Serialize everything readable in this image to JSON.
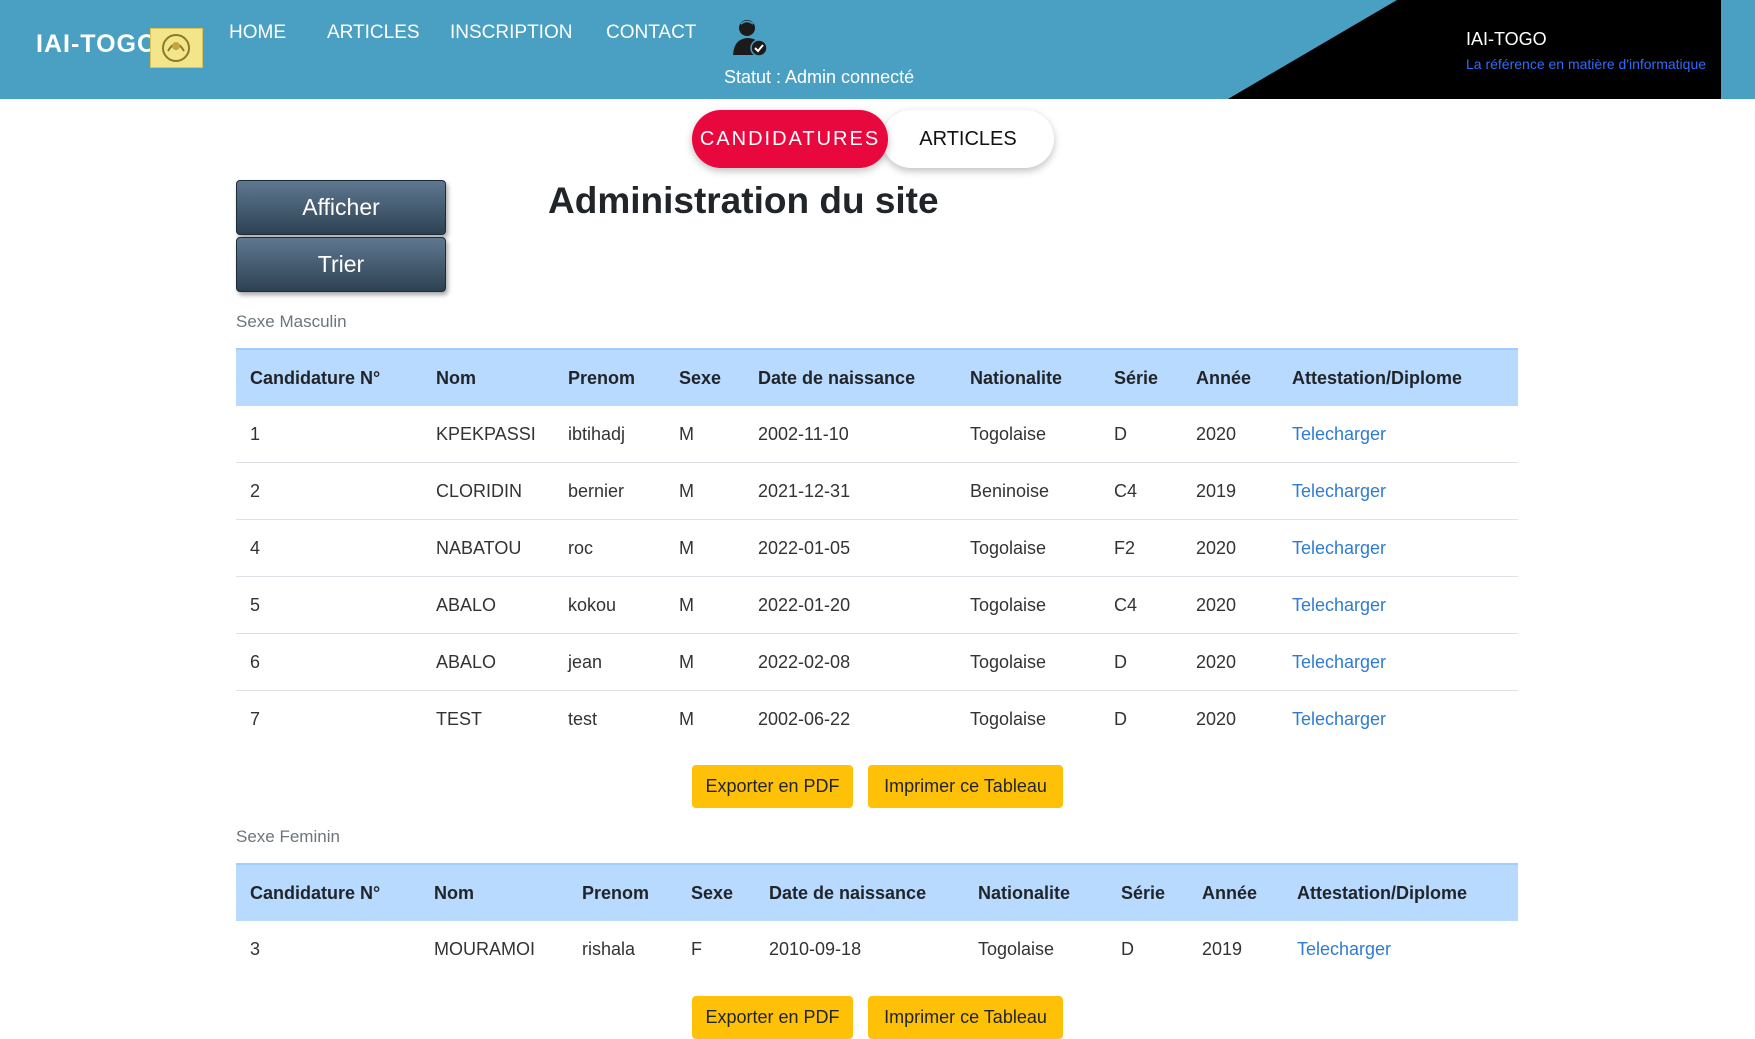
{
  "header": {
    "brand": "IAI-TOGO",
    "nav": [
      {
        "label": "HOME"
      },
      {
        "label": "ARTICLES"
      },
      {
        "label": "INSCRIPTION"
      },
      {
        "label": "CONTACT"
      }
    ],
    "status": "Statut : Admin connecté",
    "corner_title": "IAI-TOGO",
    "corner_subtitle": "La référence en matière d'informatique"
  },
  "pills": {
    "active": "CANDIDATURES",
    "other": "ARTICLES"
  },
  "sidebar": {
    "show_label": "Afficher",
    "sort_label": "Trier"
  },
  "page_title": "Administration du site",
  "table_headers": [
    "Candidature N°",
    "Nom",
    "Prenom",
    "Sexe",
    "Date de naissance",
    "Nationalite",
    "Série",
    "Année",
    "Attestation/Diplome"
  ],
  "male": {
    "label": "Sexe Masculin",
    "rows": [
      {
        "num": "1",
        "nom": "KPEKPASSI",
        "prenom": "ibtihadj",
        "sexe": "M",
        "date": "2002-11-10",
        "nationalite": "Togolaise",
        "serie": "D",
        "annee": "2020",
        "link": "Telecharger"
      },
      {
        "num": "2",
        "nom": "CLORIDIN",
        "prenom": "bernier",
        "sexe": "M",
        "date": "2021-12-31",
        "nationalite": "Beninoise",
        "serie": "C4",
        "annee": "2019",
        "link": "Telecharger"
      },
      {
        "num": "4",
        "nom": "NABATOU",
        "prenom": "roc",
        "sexe": "M",
        "date": "2022-01-05",
        "nationalite": "Togolaise",
        "serie": "F2",
        "annee": "2020",
        "link": "Telecharger"
      },
      {
        "num": "5",
        "nom": "ABALO",
        "prenom": "kokou",
        "sexe": "M",
        "date": "2022-01-20",
        "nationalite": "Togolaise",
        "serie": "C4",
        "annee": "2020",
        "link": "Telecharger"
      },
      {
        "num": "6",
        "nom": "ABALO",
        "prenom": "jean",
        "sexe": "M",
        "date": "2022-02-08",
        "nationalite": "Togolaise",
        "serie": "D",
        "annee": "2020",
        "link": "Telecharger"
      },
      {
        "num": "7",
        "nom": "TEST",
        "prenom": "test",
        "sexe": "M",
        "date": "2002-06-22",
        "nationalite": "Togolaise",
        "serie": "D",
        "annee": "2020",
        "link": "Telecharger"
      }
    ]
  },
  "female": {
    "label": "Sexe Feminin",
    "rows": [
      {
        "num": "3",
        "nom": "MOURAMOI",
        "prenom": "rishala",
        "sexe": "F",
        "date": "2010-09-18",
        "nationalite": "Togolaise",
        "serie": "D",
        "annee": "2019",
        "link": "Telecharger"
      }
    ]
  },
  "actions": {
    "export_pdf": "Exporter en PDF",
    "print_table": "Imprimer ce Tableau"
  },
  "colors": {
    "topbar": "#4aa0c2",
    "active_pill": "#e8083e",
    "table_header": "#b8daff",
    "action_button": "#ffc107",
    "link": "#2f7bd1"
  }
}
